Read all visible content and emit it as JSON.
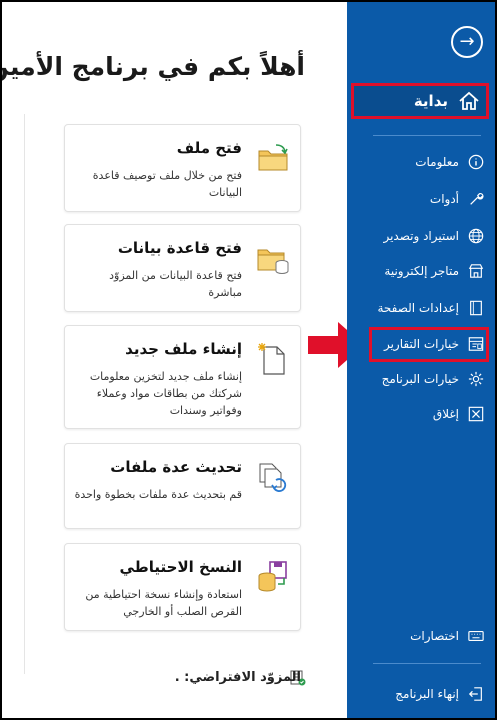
{
  "app": {
    "greeting": "أهلاً بكم في برنامج الأمين"
  },
  "sidebar": {
    "home_label": "بداية",
    "items": [
      {
        "label": "معلومات",
        "icon": "info-icon"
      },
      {
        "label": "أدوات",
        "icon": "tools-icon"
      },
      {
        "label": "استيراد وتصدير",
        "icon": "globe-icon"
      },
      {
        "label": "متاجر إلكترونية",
        "icon": "store-icon"
      },
      {
        "label": "إعدادات الصفحة",
        "icon": "page-icon"
      },
      {
        "label": "خيارات التقارير",
        "icon": "report-options-icon"
      },
      {
        "label": "خيارات البرنامج",
        "icon": "gear-icon"
      },
      {
        "label": "إغلاق",
        "icon": "close-icon"
      }
    ],
    "shortcuts_label": "اختصارات",
    "exit_label": "إنهاء البرنامج"
  },
  "cards": [
    {
      "title": "فتح ملف",
      "desc": "فتح من خلال ملف توصيف قاعدة البيانات",
      "icon": "open-folder-icon"
    },
    {
      "title": "فتح قاعدة بيانات",
      "desc": "فتح قاعدة البيانات من المزوّد مباشرة",
      "icon": "open-database-icon"
    },
    {
      "title": "إنشاء ملف جديد",
      "desc": "إنشاء ملف جديد لتخزين معلومات شركتك من بطاقات مواد وعملاء وفواتير وسندات",
      "icon": "new-file-icon"
    },
    {
      "title": "تحديث عدة ملفات",
      "desc": "قم بتحديث عدة ملفات بخطوة واحدة",
      "icon": "update-files-icon"
    },
    {
      "title": "النسخ الاحتياطي",
      "desc": "استعادة وإنشاء نسخة احتياطية من القرص الصلب أو الخارجي",
      "icon": "backup-icon"
    }
  ],
  "footer": {
    "default_provider": "المزوّد الافتراضي: ."
  },
  "colors": {
    "sidebar": "#0b5aa8",
    "highlight": "#e0102a",
    "folder": "#f4c55a"
  }
}
